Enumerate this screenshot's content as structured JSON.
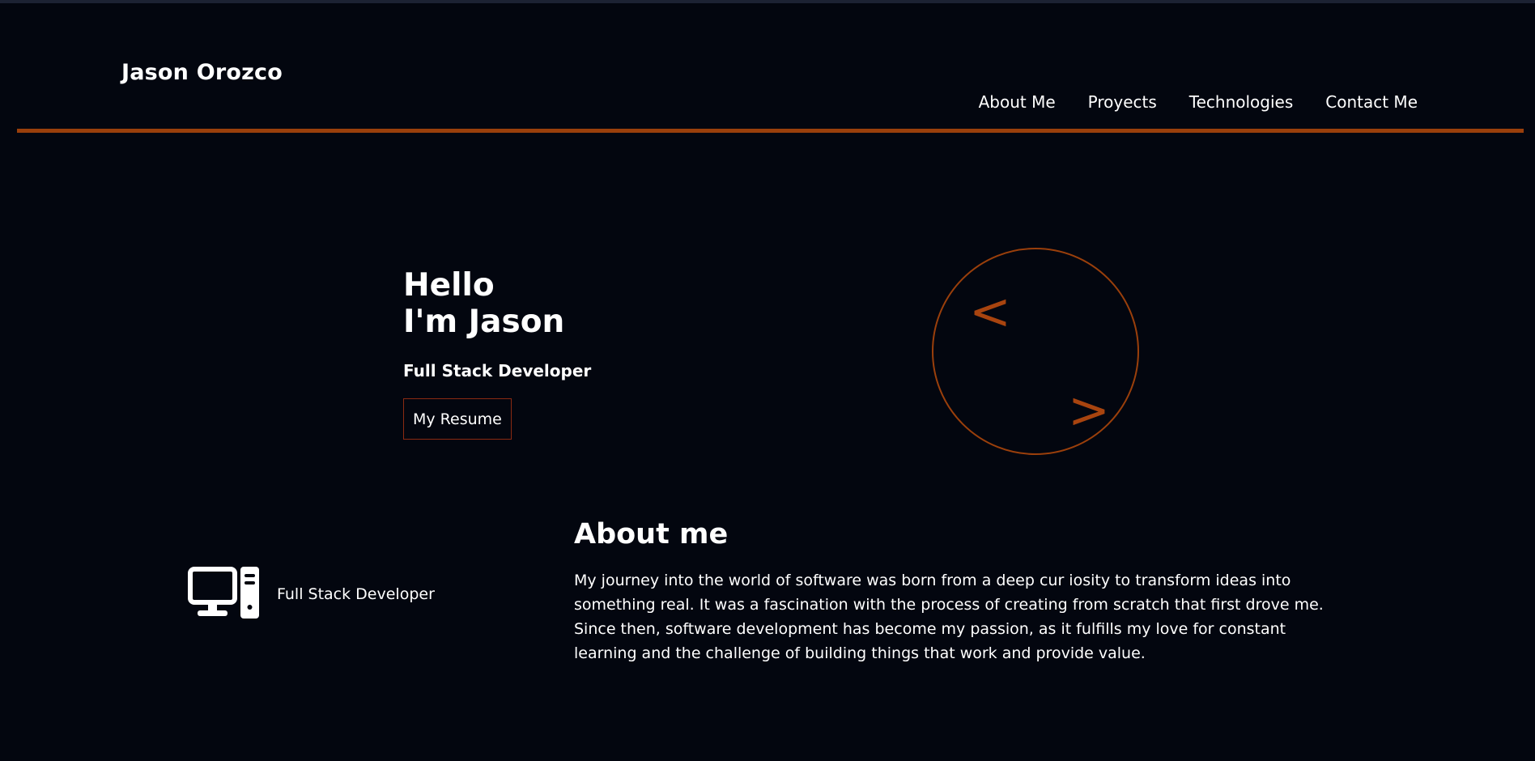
{
  "brand": "Jason Orozco",
  "nav": {
    "about": "About Me",
    "projects": "Proyects",
    "technologies": "Technologies",
    "contact": "Contact Me"
  },
  "hero": {
    "greeting_line1": "Hello",
    "greeting_line2": "I'm Jason",
    "role": "Full Stack Developer",
    "resume_label": "My Resume",
    "logo_left": "<",
    "logo_right": ">"
  },
  "about": {
    "side_label": "Full Stack Developer",
    "side_icon": "desktop-computer-icon",
    "title": "About me",
    "text": "My journey into the world of software was born from a deep cur iosity to transform ideas into something real. It was a fascination with the process of creating from scratch that first drove me. Since then, software development has become my passion, as it fulfills my love for constant learning and the challenge of building things that work and provide value."
  },
  "colors": {
    "background": "#03060f",
    "accent": "#9a3f0b",
    "text": "#ffffff"
  }
}
